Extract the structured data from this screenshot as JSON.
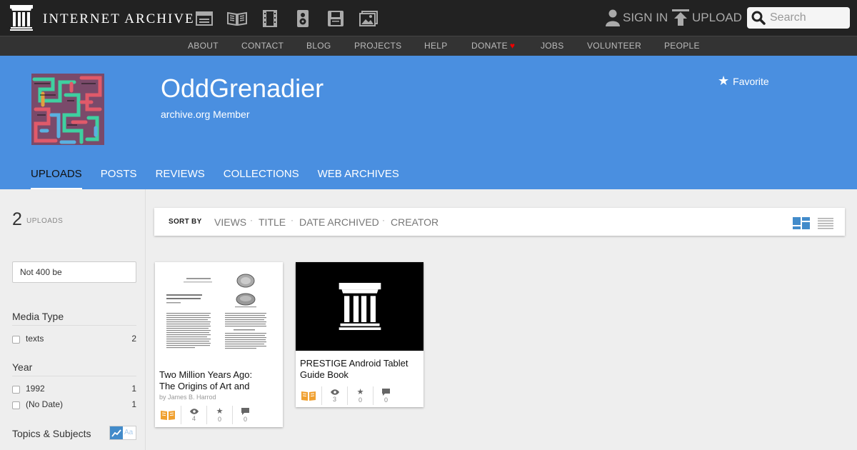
{
  "topbar": {
    "logo_text": "INTERNET ARCHIVE",
    "media_icons": [
      "web-icon",
      "texts-icon",
      "video-icon",
      "audio-icon",
      "software-icon",
      "images-icon"
    ],
    "sign_in": "SIGN IN",
    "upload": "UPLOAD",
    "search_placeholder": "Search"
  },
  "nav": {
    "items": [
      "ABOUT",
      "CONTACT",
      "BLOG",
      "PROJECTS",
      "HELP",
      "DONATE",
      "JOBS",
      "VOLUNTEER",
      "PEOPLE"
    ]
  },
  "profile": {
    "username": "OddGrenadier",
    "member_label": "archive.org Member",
    "favorite": "Favorite",
    "tabs": [
      "UPLOADS",
      "POSTS",
      "REVIEWS",
      "COLLECTIONS",
      "WEB ARCHIVES"
    ],
    "active_tab": "UPLOADS"
  },
  "sidebar": {
    "count": "2",
    "count_label": "UPLOADS",
    "filter_value": "Not 400 be",
    "facets": [
      {
        "title": "Media Type",
        "rows": [
          {
            "label": "texts",
            "count": "2"
          }
        ]
      },
      {
        "title": "Year",
        "rows": [
          {
            "label": "1992",
            "count": "1"
          },
          {
            "label": "(No Date)",
            "count": "1"
          }
        ]
      },
      {
        "title": "Topics & Subjects",
        "rows": []
      }
    ],
    "topic_toggle_text": "Aa"
  },
  "sortbar": {
    "label": "SORT BY",
    "options": [
      "VIEWS",
      "TITLE",
      "DATE ARCHIVED",
      "CREATOR"
    ]
  },
  "items": [
    {
      "title": "Two Million Years Ago: The Origins of Art and",
      "title_line1": "Two Million Years Ago:",
      "title_line2": "The Origins of Art and",
      "byline": "by James B. Harrod",
      "views": "4",
      "favorites": "0",
      "reviews": "0"
    },
    {
      "title": "PRESTIGE Android Tablet Guide Book",
      "title_line1": "PRESTIGE Android Tablet",
      "title_line2": "Guide Book",
      "views": "3",
      "favorites": "0",
      "reviews": "0"
    }
  ],
  "colors": {
    "topbar": "#222222",
    "navbar": "#333333",
    "header": "#4a8fe0",
    "book_icon": "#f0a030",
    "heart": "#ee0000"
  }
}
